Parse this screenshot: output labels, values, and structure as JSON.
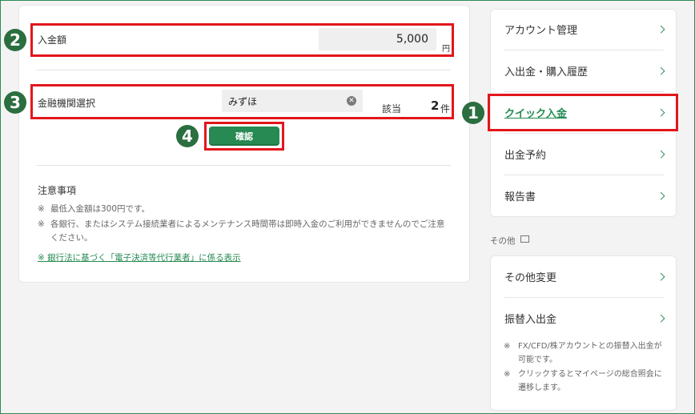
{
  "form": {
    "amount_label": "入金額",
    "amount_value": "5,000",
    "amount_unit": "円",
    "bank_label": "金融機関選択",
    "bank_value": "みずほ",
    "result_label": "該当",
    "result_count": "2",
    "result_unit": "件",
    "confirm_label": "確認"
  },
  "notes": {
    "title": "注意事項",
    "items": [
      {
        "mark": "※",
        "text": "最低入金額は300円です。"
      },
      {
        "mark": "※",
        "text": "各銀行、またはシステム接続業者によるメンテナンス時間帯は即時入金のご利用ができませんのでご注意ください。"
      }
    ],
    "link_text": "※ 銀行法に基づく「電子決済等代行業者」に係る表示"
  },
  "steps": [
    "1",
    "2",
    "3",
    "4"
  ],
  "menu": {
    "items": [
      {
        "label": "アカウント管理"
      },
      {
        "label": "入出金・購入履歴"
      },
      {
        "label": "クイック入金"
      },
      {
        "label": "出金予約"
      },
      {
        "label": "報告書"
      }
    ],
    "section_label": "その他",
    "other_items": [
      {
        "label": "その他変更"
      },
      {
        "label": "振替入出金"
      }
    ],
    "transfer_notes": [
      {
        "mark": "※",
        "text": "FX/CFD/株アカウントとの振替入出金が可能です。"
      },
      {
        "mark": "※",
        "text": "クリックするとマイページの総合照会に遷移します。"
      }
    ]
  },
  "colors": {
    "accent": "#268a52",
    "highlight": "#e2161b",
    "step_badge": "#2b6e3f"
  }
}
